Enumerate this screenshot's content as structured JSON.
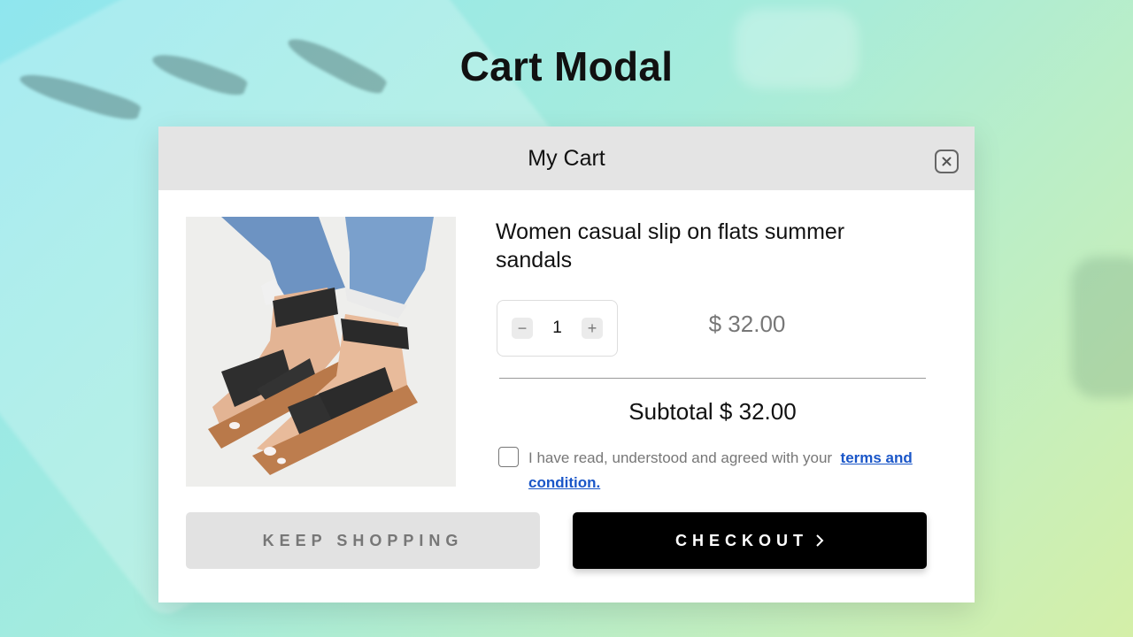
{
  "page": {
    "title": "Cart Modal"
  },
  "modal": {
    "title": "My Cart",
    "close_icon": "close-icon"
  },
  "product": {
    "name": "Women casual slip on flats summer sandals",
    "quantity": "1",
    "price": "$ 32.00",
    "decrement_label": "−",
    "increment_label": "+"
  },
  "summary": {
    "subtotal": "Subtotal $ 32.00"
  },
  "terms": {
    "text": "I have read, understood and agreed with your",
    "link": "terms and condition.",
    "checked": false
  },
  "buttons": {
    "keep_shopping": "KEEP SHOPPING",
    "checkout": "CHECKOUT"
  },
  "colors": {
    "checkout_bg": "#000000",
    "keep_shopping_bg": "#e2e2e2",
    "link": "#1a56c8",
    "header_bg": "#e4e4e4"
  }
}
